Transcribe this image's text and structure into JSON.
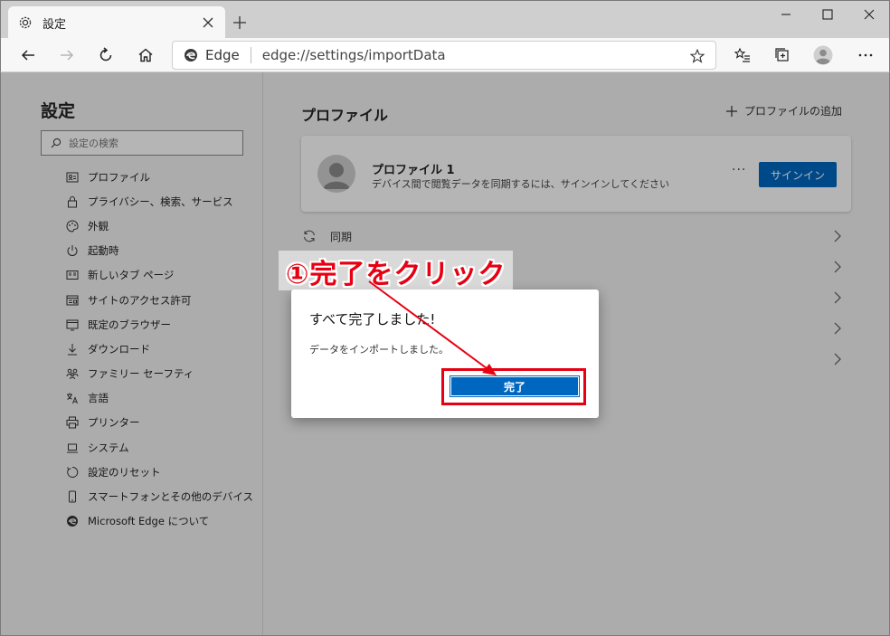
{
  "tab": {
    "title": "設定"
  },
  "address": {
    "edge_label": "Edge",
    "url": "edge://settings/importData"
  },
  "sidebar": {
    "title": "設定",
    "search_placeholder": "設定の検索",
    "items": [
      {
        "label": "プロファイル",
        "icon": "profile-card-icon"
      },
      {
        "label": "プライバシー、検索、サービス",
        "icon": "lock-icon"
      },
      {
        "label": "外観",
        "icon": "palette-icon"
      },
      {
        "label": "起動時",
        "icon": "power-icon"
      },
      {
        "label": "新しいタブ ページ",
        "icon": "newtab-page-icon"
      },
      {
        "label": "サイトのアクセス許可",
        "icon": "site-permissions-icon"
      },
      {
        "label": "既定のブラウザー",
        "icon": "default-browser-icon"
      },
      {
        "label": "ダウンロード",
        "icon": "download-icon"
      },
      {
        "label": "ファミリー セーフティ",
        "icon": "family-icon"
      },
      {
        "label": "言語",
        "icon": "language-icon"
      },
      {
        "label": "プリンター",
        "icon": "printer-icon"
      },
      {
        "label": "システム",
        "icon": "system-icon"
      },
      {
        "label": "設定のリセット",
        "icon": "reset-icon"
      },
      {
        "label": "スマートフォンとその他のデバイス",
        "icon": "phone-icon"
      },
      {
        "label": "Microsoft Edge について",
        "icon": "edge-logo-icon"
      }
    ]
  },
  "main": {
    "title": "プロファイル",
    "add_profile": "プロファイルの追加",
    "profile": {
      "name": "プロファイル 1",
      "description": "デバイス間で閲覧データを同期するには、サインインしてください",
      "more": "···",
      "signin": "サインイン"
    },
    "sync_label": "同期"
  },
  "dialog": {
    "title": "すべて完了しました!",
    "message": "データをインポートしました。",
    "done_label": "完了"
  },
  "annotation": {
    "text": "①完了をクリック",
    "color": "#e60012"
  },
  "colors": {
    "accent": "#0067c0",
    "annotation": "#e60012"
  }
}
